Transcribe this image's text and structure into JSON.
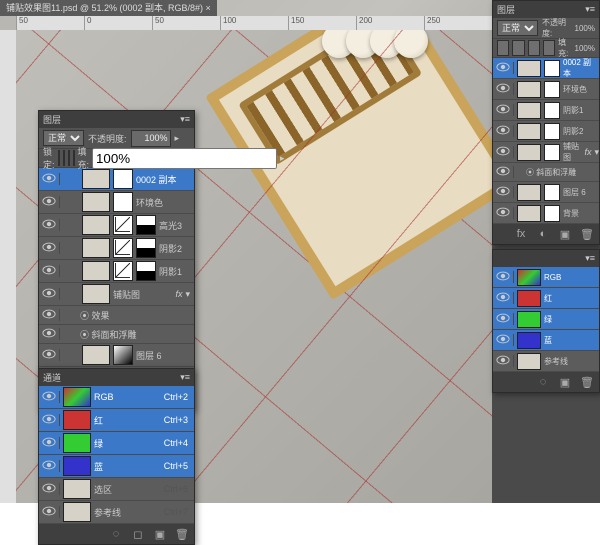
{
  "tab_title": "铺贴效果图11.psd @ 51.2% (0002 副本, RGB/8#) ×",
  "ruler": [
    "50",
    "0",
    "50",
    "100",
    "150",
    "200",
    "250"
  ],
  "layers_panel": {
    "title": "图层",
    "mode_label": "正常",
    "opacity_label": "不透明度:",
    "opacity_val": "100%",
    "lock_label": "锁定:",
    "fill_label": "填充:",
    "fill_val": "100%",
    "rows": [
      {
        "name": "0002 副本",
        "sel": true,
        "t2": "white"
      },
      {
        "name": "环境色",
        "t2": "white"
      },
      {
        "name": "高光3",
        "t2": "curve",
        "extra": "black"
      },
      {
        "name": "阴影2",
        "t2": "curve",
        "extra": "black"
      },
      {
        "name": "阴影1",
        "t2": "curve",
        "extra": "black"
      },
      {
        "name": "铺贴图",
        "fx": true
      },
      {
        "name": "图层 6",
        "t2": "grad"
      },
      {
        "name": "背景",
        "locked": true
      }
    ],
    "fx_sub1": "效果",
    "fx_sub2": "斜面和浮雕"
  },
  "channels_panel": {
    "title": "通道",
    "rows": [
      {
        "name": "RGB",
        "short": "Ctrl+2",
        "cls": "rgb",
        "sel": true
      },
      {
        "name": "红",
        "short": "Ctrl+3",
        "cls": "r",
        "sel": true
      },
      {
        "name": "绿",
        "short": "Ctrl+4",
        "cls": "g",
        "sel": true
      },
      {
        "name": "蓝",
        "short": "Ctrl+5",
        "cls": "b",
        "sel": true
      },
      {
        "name": "选区",
        "short": "Ctrl+6",
        "cls": "",
        "sel": false
      },
      {
        "name": "参考线",
        "short": "Ctrl+7",
        "cls": "",
        "sel": false
      }
    ]
  },
  "right_layers": {
    "title": "图层",
    "mode": "正常",
    "opacity_label": "不透明度:",
    "opacity_val": "100%",
    "fill_label": "填充:",
    "fill_val": "100%",
    "rows": [
      {
        "name": "0002 副本",
        "sel": true
      },
      {
        "name": "环境色"
      },
      {
        "name": "阴影1"
      },
      {
        "name": "阴影2"
      },
      {
        "name": "铺贴图",
        "fx": true
      },
      {
        "name": "图层 6"
      },
      {
        "name": "背景"
      }
    ],
    "fx_sub": "斜面和浮雕"
  },
  "right_channels": {
    "rows": [
      {
        "name": "RGB",
        "sel": true,
        "cls": "rgb"
      },
      {
        "name": "红",
        "sel": true,
        "cls": "r"
      },
      {
        "name": "绿",
        "sel": true,
        "cls": "g"
      },
      {
        "name": "蓝",
        "sel": true,
        "cls": "b"
      },
      {
        "name": "参考线",
        "sel": false
      }
    ]
  }
}
